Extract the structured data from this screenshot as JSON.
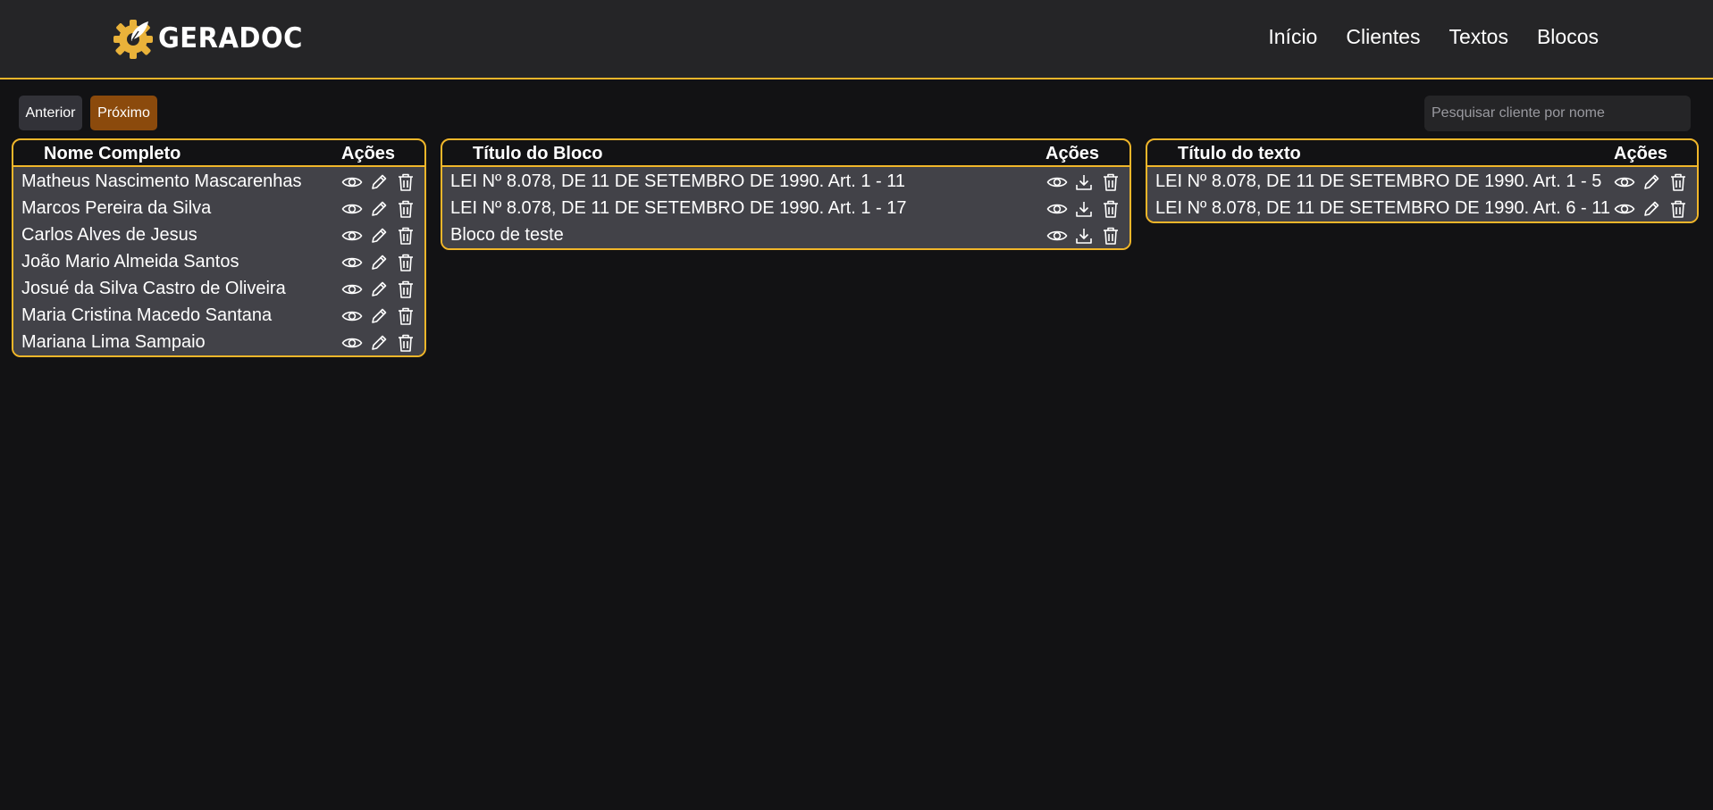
{
  "app": {
    "logo_text": "GERADOC"
  },
  "nav": [
    {
      "label": "Início"
    },
    {
      "label": "Clientes"
    },
    {
      "label": "Textos"
    },
    {
      "label": "Blocos"
    }
  ],
  "pagination": {
    "prev_label": "Anterior",
    "next_label": "Próximo"
  },
  "search": {
    "placeholder": "Pesquisar cliente por nome",
    "value": ""
  },
  "clients": {
    "header_name": "Nome Completo",
    "header_actions": "Ações",
    "action_icons": [
      "eye-icon",
      "pencil-icon",
      "trash-icon"
    ],
    "rows": [
      {
        "name": "Matheus Nascimento Mascarenhas"
      },
      {
        "name": "Marcos Pereira da Silva"
      },
      {
        "name": "Carlos Alves de Jesus"
      },
      {
        "name": "João Mario Almeida Santos"
      },
      {
        "name": "Josué da Silva Castro de Oliveira"
      },
      {
        "name": "Maria Cristina Macedo Santana"
      },
      {
        "name": "Mariana Lima Sampaio"
      }
    ]
  },
  "blocks": {
    "header_title": "Título do Bloco",
    "header_actions": "Ações",
    "action_icons": [
      "eye-icon",
      "download-icon",
      "trash-icon"
    ],
    "rows": [
      {
        "title": "LEI Nº 8.078, DE 11 DE SETEMBRO DE 1990. Art. 1 - 11"
      },
      {
        "title": "LEI Nº 8.078, DE 11 DE SETEMBRO DE 1990. Art. 1 - 17"
      },
      {
        "title": "Bloco de teste"
      }
    ]
  },
  "texts": {
    "header_title": "Título do texto",
    "header_actions": "Ações",
    "action_icons": [
      "eye-icon",
      "pencil-icon",
      "trash-icon"
    ],
    "rows": [
      {
        "title": "LEI Nº 8.078, DE 11 DE SETEMBRO DE 1990. Art. 1 - 5"
      },
      {
        "title": "LEI Nº 8.078, DE 11 DE SETEMBRO DE 1990. Art. 6 - 11"
      }
    ]
  },
  "colors": {
    "accent": "#f0b62a",
    "background": "#121214",
    "header_bg": "#252527",
    "row_bg": "#424248",
    "next_button": "#8b4a0c",
    "prev_button": "#323238"
  }
}
